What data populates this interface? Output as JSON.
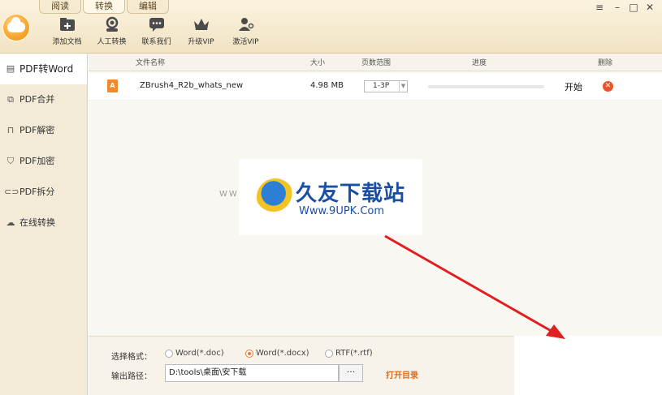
{
  "tabs": [
    {
      "label": "阅读",
      "active": false
    },
    {
      "label": "转换",
      "active": true
    },
    {
      "label": "编辑",
      "active": false
    }
  ],
  "window_controls": {
    "menu": "≡",
    "minimize": "–",
    "maximize": "□",
    "close": "✕"
  },
  "toolbar": [
    {
      "label": "添加文档",
      "icon": "add-document-icon"
    },
    {
      "label": "人工转换",
      "icon": "person-service-icon"
    },
    {
      "label": "联系我们",
      "icon": "chat-icon"
    },
    {
      "label": "升级VIP",
      "icon": "crown-icon"
    },
    {
      "label": "激活VIP",
      "icon": "user-key-icon"
    }
  ],
  "sidebar": {
    "items": [
      {
        "label": "PDF转Word",
        "icon": "word-doc-icon",
        "active": true
      },
      {
        "label": "PDF合并",
        "icon": "merge-icon",
        "active": false
      },
      {
        "label": "PDF解密",
        "icon": "unlock-icon",
        "active": false
      },
      {
        "label": "PDF加密",
        "icon": "shield-lock-icon",
        "active": false
      },
      {
        "label": "PDF拆分",
        "icon": "split-icon",
        "active": false
      },
      {
        "label": "在线转换",
        "icon": "cloud-icon",
        "active": false
      }
    ]
  },
  "table": {
    "headers": {
      "name": "文件名称",
      "size": "大小",
      "pages": "页数范围",
      "progress": "进度",
      "delete": "删除"
    },
    "rows": [
      {
        "name": "ZBrush4_R2b_whats_new",
        "size": "4.98 MB",
        "range": "1-3P",
        "progress": 0.0,
        "action": "开始"
      }
    ]
  },
  "watermark": {
    "title": "久友下载站",
    "url": "Www.9UPK.Com",
    "side": "WWW.9UPK.COM"
  },
  "options": {
    "format_label": "选择格式：",
    "formats": [
      {
        "label": "Word(*.doc)",
        "checked": false
      },
      {
        "label": "Word(*.docx)",
        "checked": true
      },
      {
        "label": "RTF(*.rtf)",
        "checked": false
      }
    ],
    "output_label": "输出路径：",
    "output_path": "D:\\tools\\桌面\\安下载",
    "browse_label": "···",
    "open_dir_label": "打开目录"
  },
  "colors": {
    "accent": "#ee7b2c",
    "delete": "#e9542a",
    "arrow": "#e02020"
  }
}
